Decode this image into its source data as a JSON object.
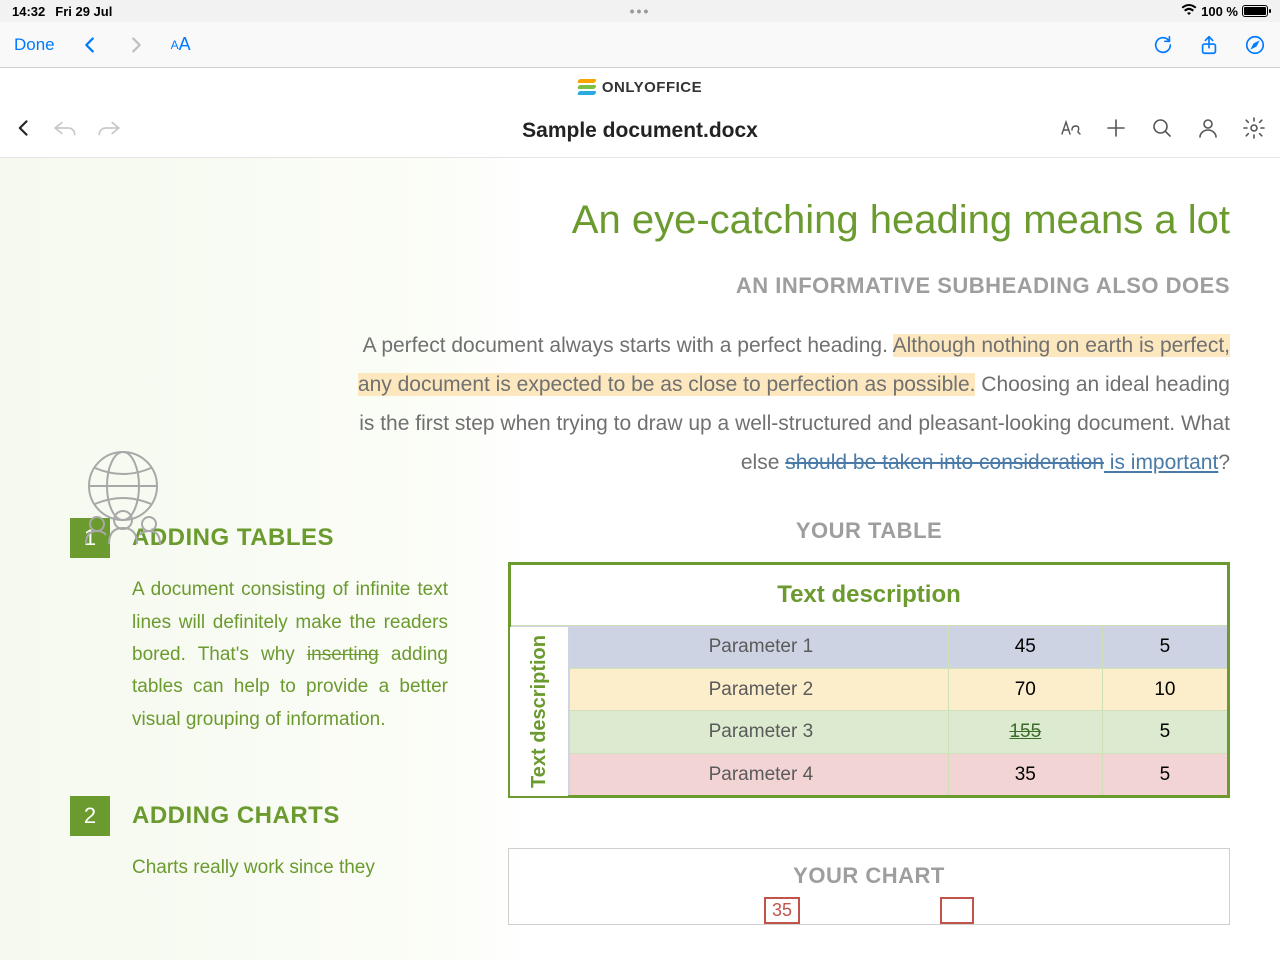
{
  "status": {
    "time": "14:32",
    "date": "Fri 29 Jul",
    "dots": "•••",
    "battery_pct": "100 %"
  },
  "safari": {
    "done": "Done",
    "aa_small": "A",
    "aa_big": "A"
  },
  "app": {
    "brand": "ONLYOFFICE",
    "filename": "Sample document.docx"
  },
  "doc": {
    "h1": "An eye-catching heading means a lot",
    "subhead": "AN INFORMATIVE SUBHEADING ALSO DOES",
    "para_pre": "A perfect document always starts with a perfect heading. ",
    "para_hl": "Although nothing on earth is perfect, any document is expected to be as close to perfection as possible.",
    "para_mid": " Choosing an ideal heading is the first step when trying to draw up a well-structured and pleasant-looking document. What else ",
    "para_strike": "should be taken into consideration",
    "para_ins": " is important",
    "para_end": "?",
    "sec1": {
      "num": "1",
      "title": "ADDING TABLES",
      "body_pre": "A document consisting of infinite text lines will definitely make the readers bored. That's why ",
      "body_strike": "inserting",
      "body_post": " adding tables can help to provide a better visual grouping of information."
    },
    "sec2": {
      "num": "2",
      "title": "ADDING CHARTS",
      "body": "Charts really work since they"
    },
    "table": {
      "title": "YOUR TABLE",
      "header": "Text description",
      "sideheader": "Text description",
      "rows": [
        {
          "label": "Parameter 1",
          "v1": "45",
          "v2": "5"
        },
        {
          "label": "Parameter 2",
          "v1": "70",
          "v2": "10"
        },
        {
          "label": "Parameter 3",
          "v1": "155",
          "v2": "5"
        },
        {
          "label": "Parameter 4",
          "v1": "35",
          "v2": "5"
        }
      ]
    },
    "chart": {
      "title": "YOUR CHART",
      "n1": "35"
    }
  }
}
